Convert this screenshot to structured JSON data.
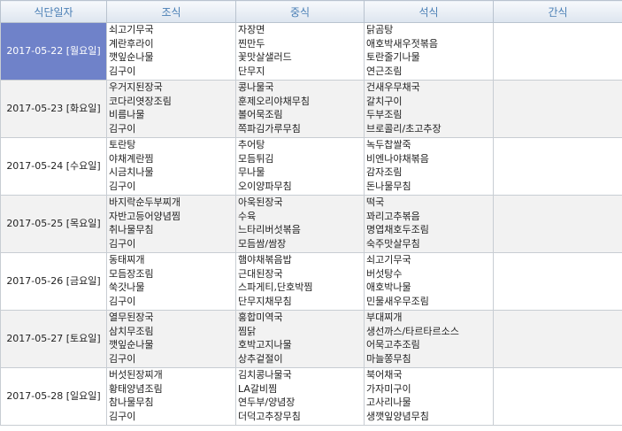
{
  "headers": {
    "date": "식단일자",
    "breakfast": "조식",
    "lunch": "중식",
    "dinner": "석식",
    "snack": "간식"
  },
  "colors": {
    "header_text": "#4a7fb5",
    "selected_bg": "#6f82c9",
    "alt_row_bg": "#f2f2f2"
  },
  "rows": [
    {
      "date": "2017-05-22 [월요일]",
      "selected": true,
      "breakfast": [
        "쇠고기무국",
        "계란후라이",
        "깻잎순나물",
        "김구이"
      ],
      "lunch": [
        "자장면",
        "찐만두",
        "꽃맛살샐러드",
        "단무지"
      ],
      "dinner": [
        "닭곰탕",
        "애호박새우젓볶음",
        "토란줄기나물",
        "연근조림"
      ],
      "snack": []
    },
    {
      "date": "2017-05-23 [화요일]",
      "selected": false,
      "breakfast": [
        "우거지된장국",
        "코다리엿장조림",
        "비름나물",
        "김구이"
      ],
      "lunch": [
        "콩나물국",
        "훈제오리야채무침",
        "볼어묵조림",
        "쪽파김가루무침"
      ],
      "dinner": [
        "건새우무채국",
        "갈치구이",
        "두부조림",
        "브로콜리/초고추장"
      ],
      "snack": []
    },
    {
      "date": "2017-05-24 [수요일]",
      "selected": false,
      "breakfast": [
        "토란탕",
        "야채계란찜",
        "시금치나물",
        "김구이"
      ],
      "lunch": [
        "추어탕",
        "모듬튀김",
        "무나물",
        "오이양파무침"
      ],
      "dinner": [
        "녹두찹쌀죽",
        "비엔나야채볶음",
        "감자조림",
        "돈나물무침"
      ],
      "snack": []
    },
    {
      "date": "2017-05-25 [목요일]",
      "selected": false,
      "breakfast": [
        "바지락순두부찌개",
        "자반고등어양념찜",
        "취나물무침",
        "김구이"
      ],
      "lunch": [
        "아욱된장국",
        "수육",
        "느타리버섯볶음",
        "모듬쌈/쌈장"
      ],
      "dinner": [
        "떡국",
        "꽈리고추볶음",
        "명엽채호두조림",
        "숙주맛살무침"
      ],
      "snack": []
    },
    {
      "date": "2017-05-26 [금요일]",
      "selected": false,
      "breakfast": [
        "동태찌개",
        "모듬장조림",
        "쑥갓나물",
        "김구이"
      ],
      "lunch": [
        "햄야채볶음밥",
        "근대된장국",
        "스파게티,단호박찜",
        "단무지채무침"
      ],
      "dinner": [
        "쇠고기무국",
        "버섯탕수",
        "애호박나물",
        "민물새우무조림"
      ],
      "snack": []
    },
    {
      "date": "2017-05-27 [토요일]",
      "selected": false,
      "breakfast": [
        "열무된장국",
        "삼치무조림",
        "깻잎순나물",
        "김구이"
      ],
      "lunch": [
        "홍합미역국",
        "찜닭",
        "호박고지나물",
        "상추겉절이"
      ],
      "dinner": [
        "부대찌개",
        "생선까스/타르타르소스",
        "어묵고추조림",
        "마늘쫑무침"
      ],
      "snack": []
    },
    {
      "date": "2017-05-28 [일요일]",
      "selected": false,
      "breakfast": [
        "버섯된장찌개",
        "황태양념조림",
        "참나물무침",
        "김구이"
      ],
      "lunch": [
        "김치콩나물국",
        "LA갈비찜",
        "연두부/양념장",
        "더덕고추장무침"
      ],
      "dinner": [
        "북어채국",
        "가자미구이",
        "고사리나물",
        "생깻잎양념무침"
      ],
      "snack": []
    }
  ]
}
